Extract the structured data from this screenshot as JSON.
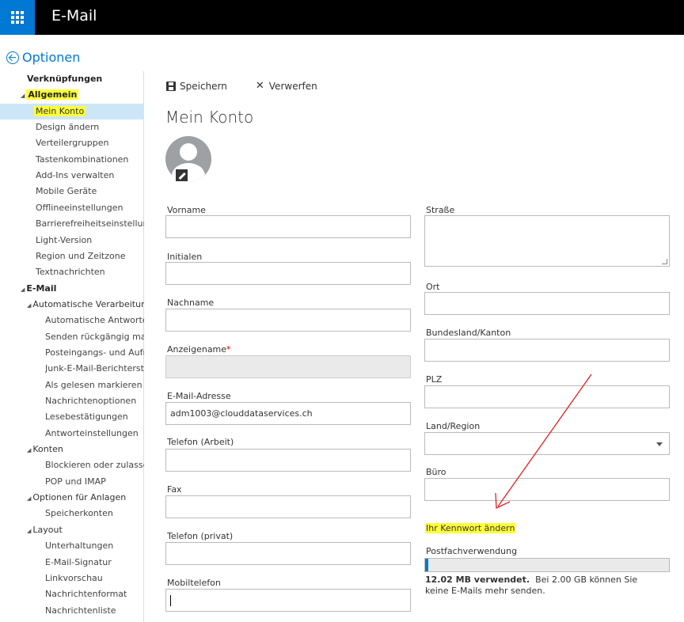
{
  "app": {
    "title": "E-Mail"
  },
  "options": {
    "title": "Optionen"
  },
  "sidebar": {
    "items": [
      {
        "label": "Verknüpfungen",
        "level": 0
      },
      {
        "label": "Allgemein",
        "level": 0,
        "highlight": true
      },
      {
        "label": "Mein Konto",
        "level": 1,
        "selected": true,
        "highlight": true
      },
      {
        "label": "Design ändern",
        "level": 1
      },
      {
        "label": "Verteilergruppen",
        "level": 1
      },
      {
        "label": "Tastenkombinationen",
        "level": 1
      },
      {
        "label": "Add-Ins verwalten",
        "level": 1
      },
      {
        "label": "Mobile Geräte",
        "level": 1
      },
      {
        "label": "Offlineeinstellungen",
        "level": 1
      },
      {
        "label": "Barrierefreiheitseinstellungen",
        "level": 1
      },
      {
        "label": "Light-Version",
        "level": 1
      },
      {
        "label": "Region und Zeitzone",
        "level": 1
      },
      {
        "label": "Textnachrichten",
        "level": 1
      },
      {
        "label": "E-Mail",
        "level": 0
      },
      {
        "label": "Automatische Verarbeitung",
        "level": 1
      },
      {
        "label": "Automatische Antworten",
        "level": 2
      },
      {
        "label": "Senden rückgängig machen",
        "level": 2
      },
      {
        "label": "Posteingangs- und Aufräumregeln",
        "level": 2
      },
      {
        "label": "Junk-E-Mail-Berichterstattung",
        "level": 2
      },
      {
        "label": "Als gelesen markieren",
        "level": 2
      },
      {
        "label": "Nachrichtenoptionen",
        "level": 2
      },
      {
        "label": "Lesebestätigungen",
        "level": 2
      },
      {
        "label": "Antworteinstellungen",
        "level": 2
      },
      {
        "label": "Konten",
        "level": 1
      },
      {
        "label": "Blockieren oder zulassen",
        "level": 2
      },
      {
        "label": "POP und IMAP",
        "level": 2
      },
      {
        "label": "Optionen für Anlagen",
        "level": 1
      },
      {
        "label": "Speicherkonten",
        "level": 2
      },
      {
        "label": "Layout",
        "level": 1
      },
      {
        "label": "Unterhaltungen",
        "level": 2
      },
      {
        "label": "E-Mail-Signatur",
        "level": 2
      },
      {
        "label": "Linkvorschau",
        "level": 2
      },
      {
        "label": "Nachrichtenformat",
        "level": 2
      },
      {
        "label": "Nachrichtenliste",
        "level": 2
      }
    ]
  },
  "toolbar": {
    "save_label": "Speichern",
    "discard_label": "Verwerfen"
  },
  "page": {
    "title": "Mein Konto"
  },
  "form": {
    "vorname": {
      "label": "Vorname",
      "value": ""
    },
    "initialen": {
      "label": "Initialen",
      "value": ""
    },
    "nachname": {
      "label": "Nachname",
      "value": ""
    },
    "anzeigename": {
      "label": "Anzeigename",
      "required_mark": "*",
      "value": ""
    },
    "email": {
      "label": "E-Mail-Adresse",
      "value": "adm1003@clouddataservices.ch"
    },
    "telefon_arbeit": {
      "label": "Telefon (Arbeit)",
      "value": ""
    },
    "fax": {
      "label": "Fax",
      "value": ""
    },
    "telefon_privat": {
      "label": "Telefon (privat)",
      "value": ""
    },
    "mobiltelefon": {
      "label": "Mobiltelefon",
      "value": ""
    },
    "strasse": {
      "label": "Straße",
      "value": ""
    },
    "ort": {
      "label": "Ort",
      "value": ""
    },
    "bundesland": {
      "label": "Bundesland/Kanton",
      "value": ""
    },
    "plz": {
      "label": "PLZ",
      "value": ""
    },
    "land": {
      "label": "Land/Region",
      "value": ""
    },
    "buero": {
      "label": "Büro",
      "value": ""
    }
  },
  "password": {
    "link_label": "Ihr Kennwort ändern"
  },
  "mailbox": {
    "label": "Postfachverwendung",
    "used": "12.02 MB verwendet.",
    "note": "Bei 2.00 GB können Sie keine E-Mails mehr senden.",
    "usage_fraction": 0.006
  },
  "colors": {
    "accent": "#0078d4",
    "highlight": "#ffff3a",
    "annotation_arrow": "#e02020",
    "selected_row": "#cde6f7"
  },
  "icons": {
    "waffle": "app-launcher-icon",
    "back": "back-arrow-icon",
    "save": "save-icon",
    "discard": "close-icon",
    "avatar": "user-avatar",
    "edit": "pencil-icon",
    "dropdown": "chevron-down-icon"
  }
}
